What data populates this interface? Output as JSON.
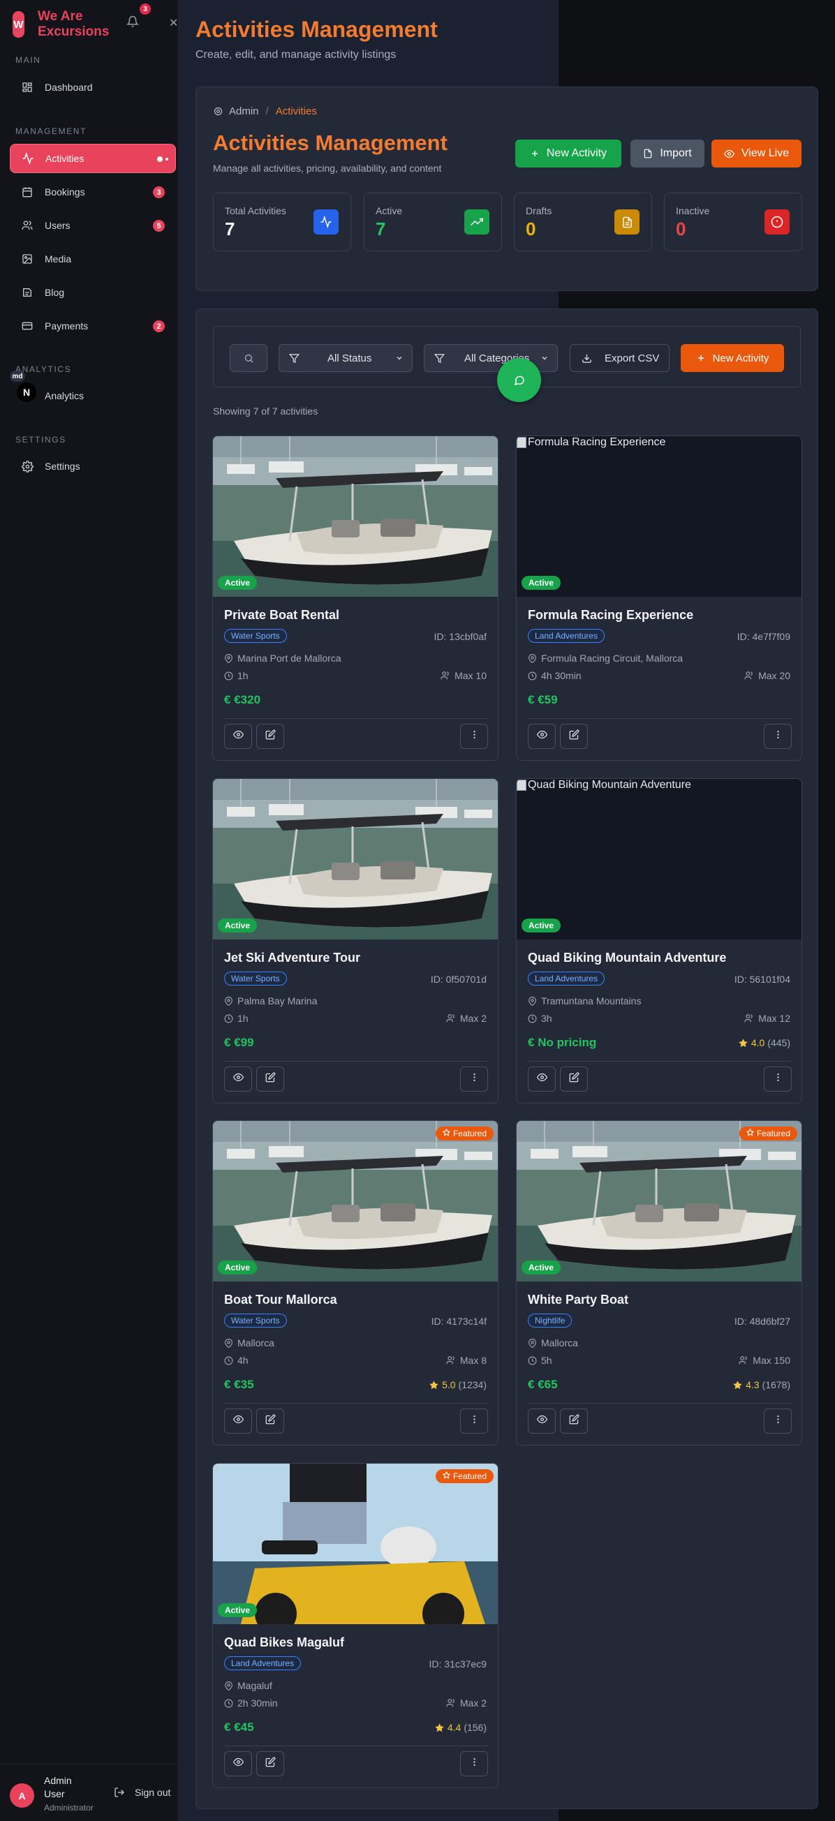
{
  "brand": {
    "logo_letter": "W",
    "name": "We Are Excursions",
    "notification_count": "3"
  },
  "sidebar": {
    "sections": {
      "main": "MAIN",
      "management": "MANAGEMENT",
      "analytics": "ANALYTICS",
      "settings": "SETTINGS"
    },
    "items": [
      {
        "label": "Dashboard",
        "icon": "dashboard-icon"
      },
      {
        "label": "Activities",
        "icon": "activity-icon",
        "active": true
      },
      {
        "label": "Bookings",
        "icon": "calendar-icon",
        "badge": "3"
      },
      {
        "label": "Users",
        "icon": "users-icon",
        "badge": "5"
      },
      {
        "label": "Media",
        "icon": "image-icon"
      },
      {
        "label": "Blog",
        "icon": "blog-icon"
      },
      {
        "label": "Payments",
        "icon": "credit-card-icon",
        "badge": "2"
      },
      {
        "label": "Analytics",
        "icon": "analytics-icon"
      },
      {
        "label": "Settings",
        "icon": "gear-icon"
      }
    ],
    "md_tag": "md",
    "n_logo": "N"
  },
  "user": {
    "initial": "A",
    "name": "Admin User",
    "role": "Administrator",
    "signout_label": "Sign out"
  },
  "page": {
    "title": "Activities Management",
    "subtitle": "Create, edit, and manage activity listings"
  },
  "header_card": {
    "breadcrumb": {
      "root": "Admin",
      "separator": "/",
      "current": "Activities"
    },
    "title": "Activities Management",
    "subtitle": "Manage all activities, pricing, availability, and content",
    "buttons": {
      "new_activity": "New Activity",
      "import": "Import",
      "view_live": "View Live"
    },
    "stats": [
      {
        "label": "Total Activities",
        "value": "7",
        "color": "#ffffff",
        "icon_bg": "#2563eb"
      },
      {
        "label": "Active",
        "value": "7",
        "color": "#22c55e",
        "icon_bg": "#16a34a"
      },
      {
        "label": "Drafts",
        "value": "0",
        "color": "#eab308",
        "icon_bg": "#ca8a04"
      },
      {
        "label": "Inactive",
        "value": "0",
        "color": "#ef4444",
        "icon_bg": "#dc2626"
      }
    ]
  },
  "filters": {
    "status": "All Status",
    "category": "All Categories",
    "export": "Export CSV",
    "new_activity": "New Activity",
    "showing": "Showing 7 of 7 activities"
  },
  "activities": [
    {
      "title": "Private Boat Rental",
      "category": "Water Sports",
      "id": "ID: 13cbf0af",
      "location": "Marina Port de Mallorca",
      "duration": "1h",
      "max": "Max 10",
      "price": "€320",
      "rating": "",
      "reviews": "",
      "status": "Active",
      "featured": "",
      "image": "boat",
      "alt": ""
    },
    {
      "title": "Formula Racing Experience",
      "category": "Land Adventures",
      "id": "ID: 4e7f7f09",
      "location": "Formula Racing Circuit, Mallorca",
      "duration": "4h 30min",
      "max": "Max 20",
      "price": "€59",
      "rating": "",
      "reviews": "",
      "status": "Active",
      "featured": "",
      "image": "broken",
      "alt": "Formula Racing Experience"
    },
    {
      "title": "Jet Ski Adventure Tour",
      "category": "Water Sports",
      "id": "ID: 0f50701d",
      "location": "Palma Bay Marina",
      "duration": "1h",
      "max": "Max 2",
      "price": "€99",
      "rating": "",
      "reviews": "",
      "status": "Active",
      "featured": "",
      "image": "boat",
      "alt": ""
    },
    {
      "title": "Quad Biking Mountain Adventure",
      "category": "Land Adventures",
      "id": "ID: 56101f04",
      "location": "Tramuntana Mountains",
      "duration": "3h",
      "max": "Max 12",
      "price": "No pricing",
      "rating": "4.0",
      "reviews": "(445)",
      "status": "Active",
      "featured": "",
      "image": "broken",
      "alt": "Quad Biking Mountain Adventure"
    },
    {
      "title": "Boat Tour Mallorca",
      "category": "Water Sports",
      "id": "ID: 4173c14f",
      "location": "Mallorca",
      "duration": "4h",
      "max": "Max 8",
      "price": "€35",
      "rating": "5.0",
      "reviews": "(1234)",
      "status": "Active",
      "featured": "Featured",
      "image": "boat",
      "alt": ""
    },
    {
      "title": "White Party Boat",
      "category": "Nightlife",
      "id": "ID: 48d6bf27",
      "location": "Mallorca",
      "duration": "5h",
      "max": "Max 150",
      "price": "€65",
      "rating": "4.3",
      "reviews": "(1678)",
      "status": "Active",
      "featured": "Featured",
      "image": "boat",
      "alt": ""
    },
    {
      "title": "Quad Bikes Magaluf",
      "category": "Land Adventures",
      "id": "ID: 31c37ec9",
      "location": "Magaluf",
      "duration": "2h 30min",
      "max": "Max 2",
      "price": "€45",
      "rating": "4.4",
      "reviews": "(156)",
      "status": "Active",
      "featured": "Featured",
      "image": "quad",
      "alt": ""
    }
  ],
  "currency_symbol": "€",
  "colors": {
    "brand": "#e8425d",
    "accent": "#f47b30",
    "success": "#16a34a",
    "primary_orange": "#ea580c"
  }
}
